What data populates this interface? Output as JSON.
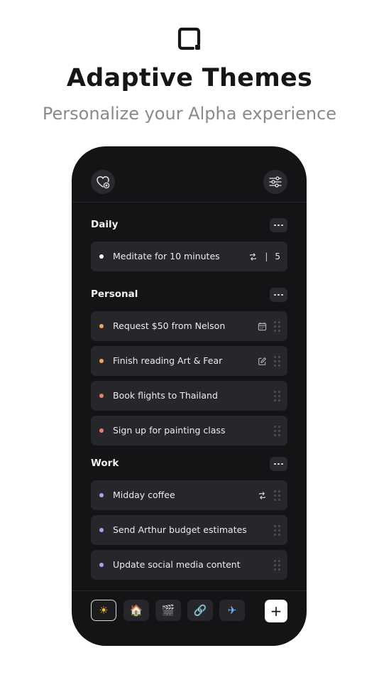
{
  "header": {
    "title": "Adaptive Themes",
    "subtitle": "Personalize your Alpha experience"
  },
  "top_bar": {
    "left_icon": "heart-plus-icon",
    "right_icon": "sliders-icon"
  },
  "sections": [
    {
      "title": "Daily",
      "tasks": [
        {
          "label": "Meditate for 10 minutes",
          "dot_color": "#ffffff",
          "repeat": true,
          "separator": "|",
          "count": "5"
        }
      ]
    },
    {
      "title": "Personal",
      "tasks": [
        {
          "label": "Request $50 from Nelson",
          "dot_color": "#f2a45b",
          "icon": "calendar-icon"
        },
        {
          "label": "Finish reading Art & Fear",
          "dot_color": "#f2a45b",
          "icon": "edit-icon"
        },
        {
          "label": "Book flights to Thailand",
          "dot_color": "#ef7b74"
        },
        {
          "label": "Sign up for painting class",
          "dot_color": "#ef7b74"
        }
      ]
    },
    {
      "title": "Work",
      "tasks": [
        {
          "label": "Midday coffee",
          "dot_color": "#b998f0",
          "icon": "repeat-icon"
        },
        {
          "label": "Send Arthur budget estimates",
          "dot_color": "#b998f0"
        },
        {
          "label": "Update social media content",
          "dot_color": "#b998f0"
        }
      ]
    }
  ],
  "bottom_bar": {
    "tabs": [
      {
        "emoji": "☀",
        "name": "sun-icon",
        "active": true
      },
      {
        "emoji": "🏠",
        "name": "house-icon",
        "active": false
      },
      {
        "emoji": "🎬",
        "name": "clapper-icon",
        "active": false
      },
      {
        "emoji": "🔗",
        "name": "link-icon",
        "active": false
      },
      {
        "emoji": "✈",
        "name": "airplane-icon",
        "active": false
      }
    ],
    "add_label": "+"
  },
  "colors": {
    "phone_bg": "#141417",
    "card_bg": "#27272b",
    "orange": "#f2a45b",
    "red": "#ef7b74",
    "purple": "#b998f0"
  }
}
